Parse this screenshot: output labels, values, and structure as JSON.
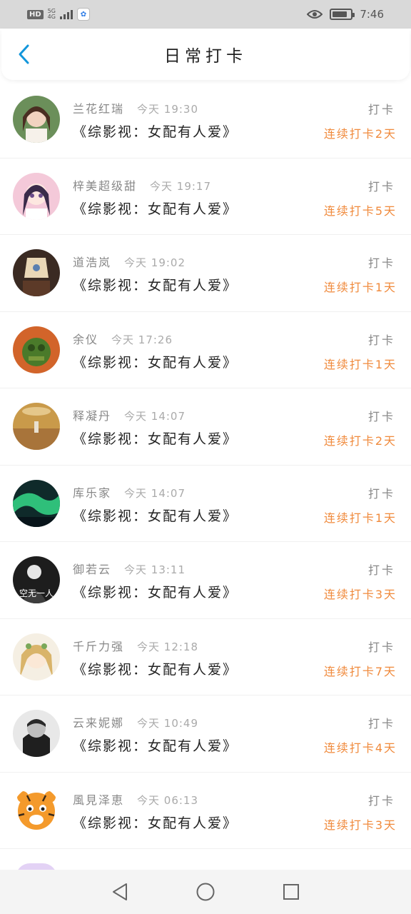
{
  "status_bar": {
    "hd": "HD",
    "network": "5G",
    "network_sub": "4G",
    "time": "7:46",
    "battery_level": 0.8
  },
  "header": {
    "title": "日常打卡",
    "back_icon": "chevron-left-icon"
  },
  "colors": {
    "accent": "#1296db",
    "streak": "#f08a3c",
    "muted": "#888888"
  },
  "items": [
    {
      "name": "兰花红瑞",
      "time": "今天 19:30",
      "book": "《综影视：女配有人爱》",
      "action": "打卡",
      "streak": "连续打卡2天"
    },
    {
      "name": "梓美超级甜",
      "time": "今天 19:17",
      "book": "《综影视：女配有人爱》",
      "action": "打卡",
      "streak": "连续打卡5天"
    },
    {
      "name": "道浩岚",
      "time": "今天 19:02",
      "book": "《综影视：女配有人爱》",
      "action": "打卡",
      "streak": "连续打卡1天"
    },
    {
      "name": "余仪",
      "time": "今天 17:26",
      "book": "《综影视：女配有人爱》",
      "action": "打卡",
      "streak": "连续打卡1天"
    },
    {
      "name": "释凝丹",
      "time": "今天 14:07",
      "book": "《综影视：女配有人爱》",
      "action": "打卡",
      "streak": "连续打卡2天"
    },
    {
      "name": "库乐家",
      "time": "今天 14:07",
      "book": "《综影视：女配有人爱》",
      "action": "打卡",
      "streak": "连续打卡1天"
    },
    {
      "name": "御若云",
      "time": "今天 13:11",
      "book": "《综影视：女配有人爱》",
      "action": "打卡",
      "streak": "连续打卡3天",
      "avatar_text": "空无一人"
    },
    {
      "name": "千斤力强",
      "time": "今天 12:18",
      "book": "《综影视：女配有人爱》",
      "action": "打卡",
      "streak": "连续打卡7天"
    },
    {
      "name": "云来妮娜",
      "time": "今天 10:49",
      "book": "《综影视：女配有人爱》",
      "action": "打卡",
      "streak": "连续打卡4天"
    },
    {
      "name": "風見泽恵",
      "time": "今天 06:13",
      "book": "《综影视：女配有人爱》",
      "action": "打卡",
      "streak": "连续打卡3天"
    }
  ],
  "nav": {
    "back": "triangle-back-icon",
    "home": "circle-home-icon",
    "recents": "square-recents-icon"
  }
}
